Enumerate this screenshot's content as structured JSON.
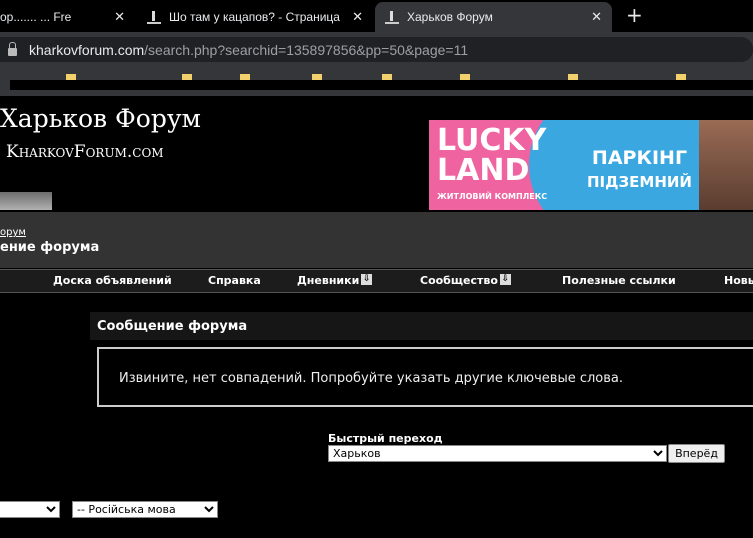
{
  "browser": {
    "tabs": [
      {
        "title": "ор....... ... Fre",
        "active": false
      },
      {
        "title": "Шо там у кацапов? - Страница",
        "active": false
      },
      {
        "title": "Харьков Форум",
        "active": true
      }
    ],
    "new_tab": "+",
    "close": "✕",
    "url_host": "kharkovforum.com",
    "url_path": "/search.php?searchid=135897856&pp=50&page=11"
  },
  "header": {
    "logo_line1": "Харьков Форум",
    "logo_line2": "KharkovForum.com",
    "banner": {
      "brand1": "LUCKY",
      "brand2": "LAND",
      "tagline": "ЖИТЛОВИЙ КОМПЛЕКС",
      "offer1": "ПАРКІНГ",
      "offer2": "ПІДЗЕМНИЙ"
    }
  },
  "breadcrumb": {
    "link": "орум",
    "title": "ение форума"
  },
  "nav": [
    {
      "label": "Доска объявлений"
    },
    {
      "label": "Справка"
    },
    {
      "label": "Дневники",
      "dropdown": true
    },
    {
      "label": "Сообщество",
      "dropdown": true
    },
    {
      "label": "Полезные ссылки"
    },
    {
      "label": "Новы"
    }
  ],
  "message": {
    "title": "Сообщение форума",
    "text": "Извините, нет совпадений. Попробуйте указать другие ключевые слова."
  },
  "quick_jump": {
    "label": "Быстрый переход",
    "selected": "Харьков",
    "button": "Вперёд"
  },
  "footer": {
    "style_select": "",
    "language_select": "-- Російська мова"
  },
  "colors": {
    "banner_pink": "#ef64a0",
    "banner_blue": "#3aa7e0"
  }
}
